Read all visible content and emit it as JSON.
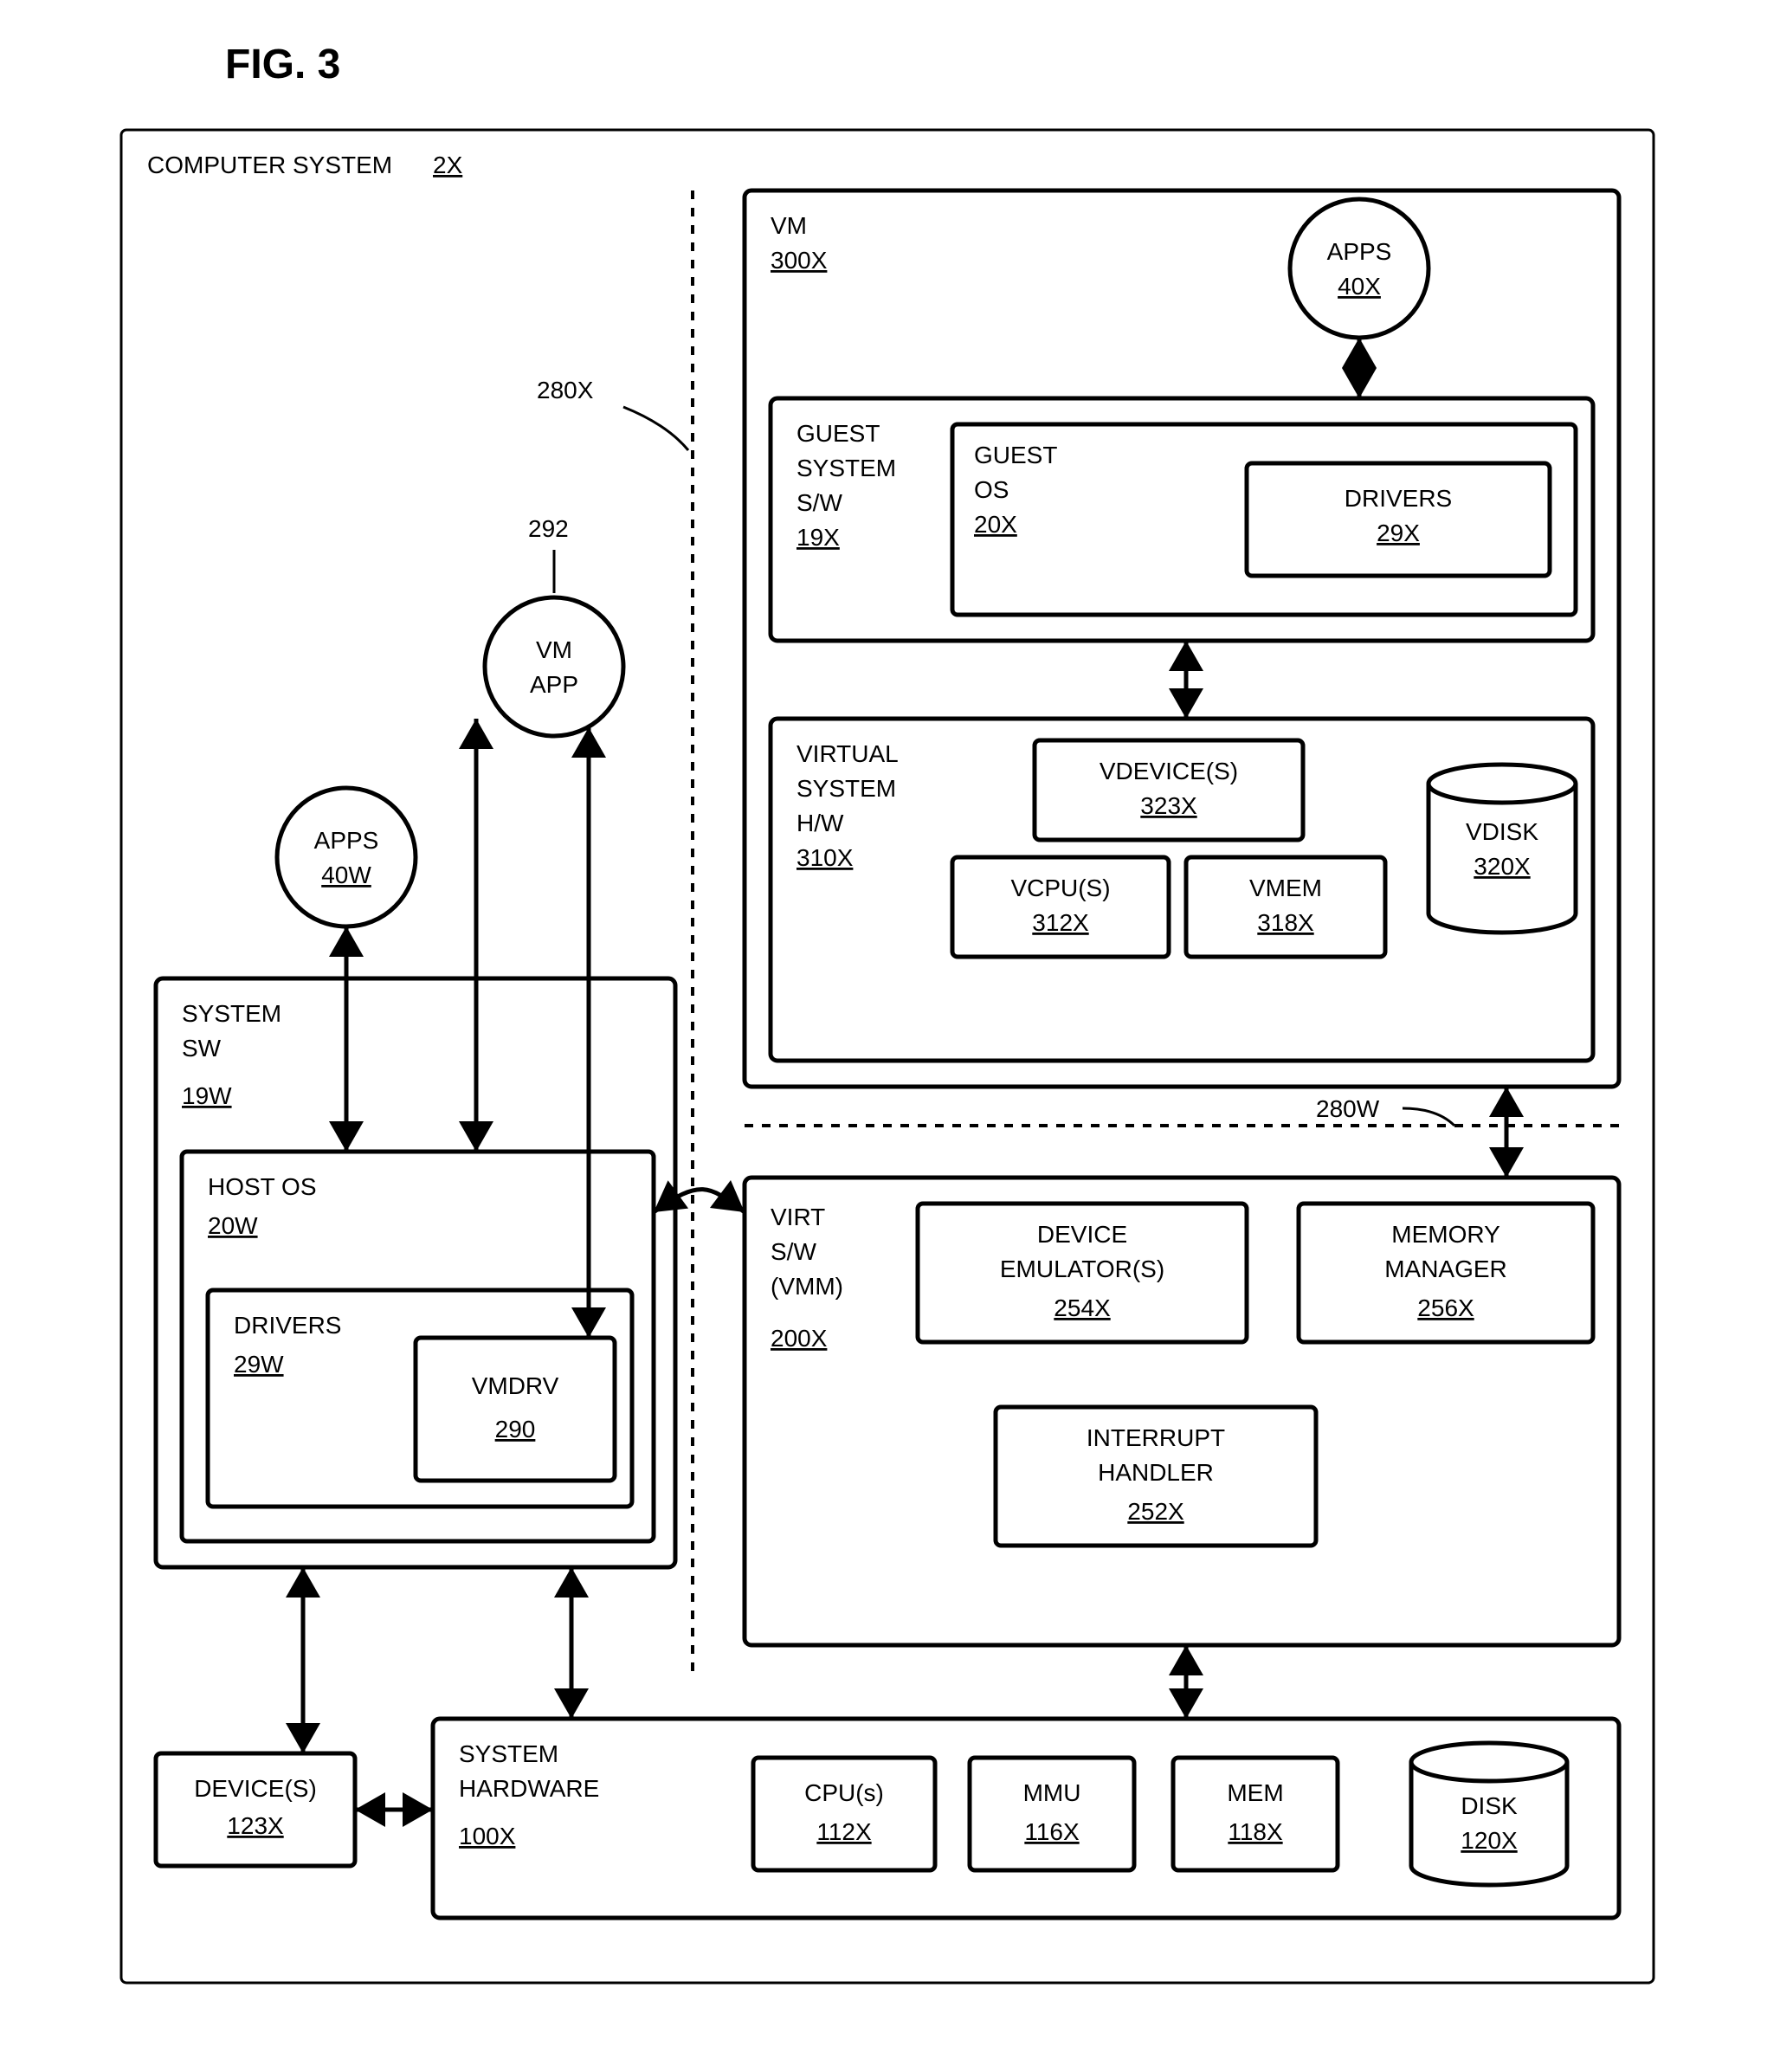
{
  "figure": {
    "title": "FIG. 3"
  },
  "outer": {
    "label": "COMPUTER SYSTEM",
    "ref": "2X"
  },
  "callouts": {
    "c280x": "280X",
    "c292": "292",
    "c280w": "280W"
  },
  "apps40w": {
    "label": "APPS",
    "ref": "40W"
  },
  "vmapp": {
    "line1": "VM",
    "line2": "APP"
  },
  "syssw": {
    "line1": "SYSTEM",
    "line2": "SW",
    "ref": "19W"
  },
  "hostos": {
    "label": "HOST OS",
    "ref": "20W"
  },
  "drivers29w": {
    "label": "DRIVERS",
    "ref": "29W"
  },
  "vmdrv": {
    "label": "VMDRV",
    "ref": "290"
  },
  "vm": {
    "label": "VM",
    "ref": "300X"
  },
  "apps40x": {
    "label": "APPS",
    "ref": "40X"
  },
  "guestsystem": {
    "line1": "GUEST",
    "line2": "SYSTEM",
    "line3": "S/W",
    "ref": "19X"
  },
  "guestos": {
    "line1": "GUEST",
    "line2": "OS",
    "ref": "20X"
  },
  "drivers29x": {
    "label": "DRIVERS",
    "ref": "29X"
  },
  "virtsyshw": {
    "line1": "VIRTUAL",
    "line2": "SYSTEM",
    "line3": "H/W",
    "ref": "310X"
  },
  "vdevices": {
    "label": "VDEVICE(S)",
    "ref": "323X"
  },
  "vcpus": {
    "label": "VCPU(S)",
    "ref": "312X"
  },
  "vmem": {
    "label": "VMEM",
    "ref": "318X"
  },
  "vdisk": {
    "label": "VDISK",
    "ref": "320X"
  },
  "virtsw": {
    "line1": "VIRT",
    "line2": "S/W",
    "line3": "(VMM)",
    "ref": "200X"
  },
  "devemu": {
    "line1": "DEVICE",
    "line2": "EMULATOR(S)",
    "ref": "254X"
  },
  "memmgr": {
    "line1": "MEMORY",
    "line2": "MANAGER",
    "ref": "256X"
  },
  "inthand": {
    "line1": "INTERRUPT",
    "line2": "HANDLER",
    "ref": "252X"
  },
  "devices": {
    "label": "DEVICE(S)",
    "ref": "123X"
  },
  "syshw": {
    "line1": "SYSTEM",
    "line2": "HARDWARE",
    "ref": "100X"
  },
  "cpus": {
    "label": "CPU(s)",
    "ref": "112X"
  },
  "mmu": {
    "label": "MMU",
    "ref": "116X"
  },
  "mem": {
    "label": "MEM",
    "ref": "118X"
  },
  "disk": {
    "label": "DISK",
    "ref": "120X"
  }
}
